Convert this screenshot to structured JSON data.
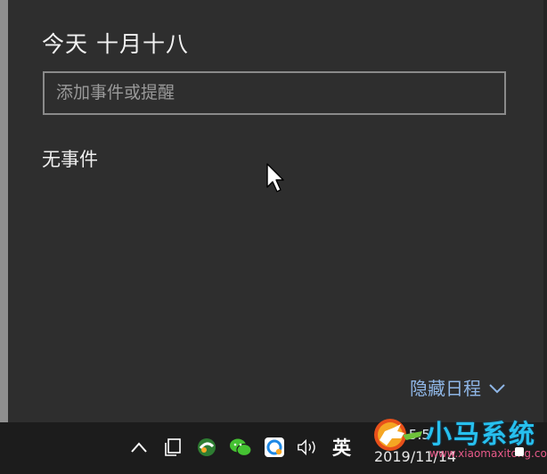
{
  "calendar": {
    "date_title": "今天 十月十八",
    "event_input_placeholder": "添加事件或提醒",
    "no_events_text": "无事件",
    "hide_agenda_label": "隐藏日程"
  },
  "taskbar": {
    "ime_label": "英",
    "clock_time": "15:5",
    "clock_date": "2019/11/14",
    "icons": [
      "chevron-up-icon",
      "task-view-icon",
      "app-icon",
      "wechat-icon",
      "app-icon",
      "volume-icon"
    ]
  },
  "watermark": {
    "title": "小马系统",
    "url": "www.xiaomaxitong.com"
  },
  "colors": {
    "panel_bg": "#2e2e2e",
    "accent_link": "#8fb6e6",
    "taskbar_bg": "#1c1c1c",
    "watermark_blue": "#27c0ee"
  }
}
